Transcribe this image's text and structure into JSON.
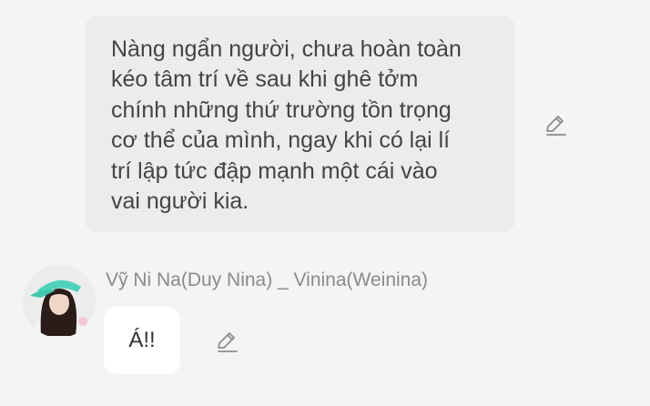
{
  "narration": {
    "lines": [
      "Nàng ngẩn người, chưa hoàn toàn",
      "kéo tâm trí về sau khi ghê tởm",
      "chính những thứ trường tồn trọng",
      "cơ thể của mình, ngay khi có lại lí",
      "trí lập tức đập mạnh một cái vào",
      "vai người kia."
    ],
    "edit_icon": "pencil-edit-icon"
  },
  "dialog": {
    "speaker_name": "Vỹ Ni Na(Duy Nina) _ Vinina(Weinina)",
    "text": "Á!!",
    "avatar_icon": "character-avatar",
    "edit_icon": "pencil-edit-icon"
  },
  "colors": {
    "background": "#f4f4f4",
    "narration_bubble": "#ececec",
    "dialog_bubble": "#ffffff",
    "text": "#444444",
    "name_text": "#8a8a8a",
    "icon": "#8c8c8c"
  }
}
